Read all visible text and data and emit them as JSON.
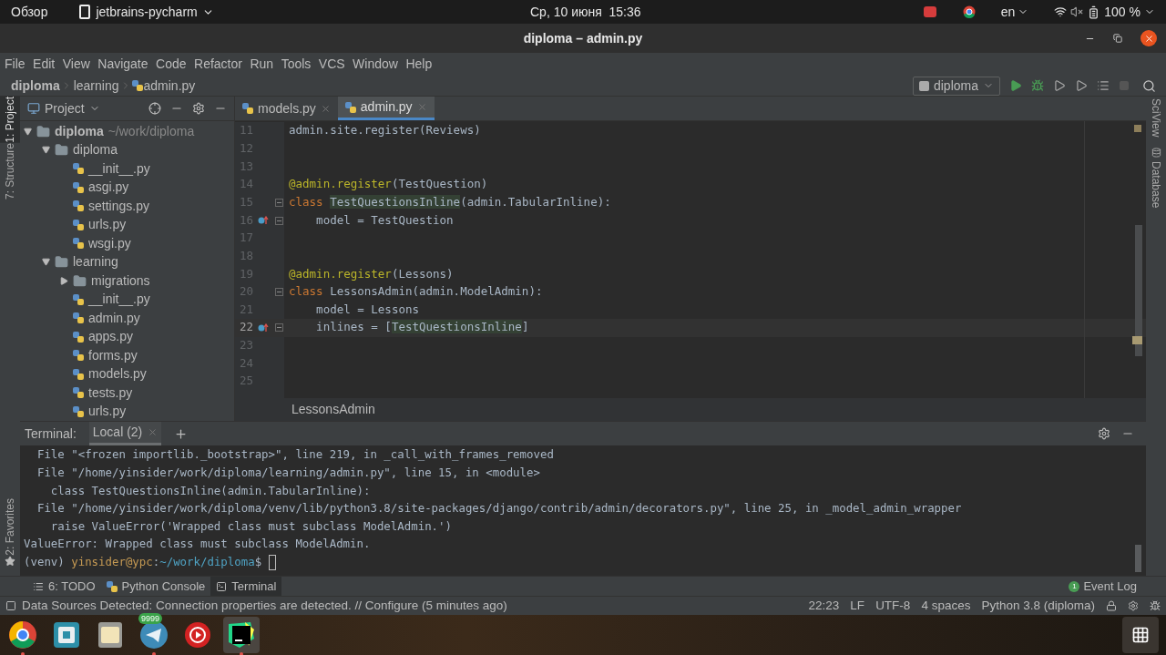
{
  "top_bar": {
    "activities": "Обзор",
    "app": "jetbrains-pycharm",
    "clock": "Ср, 10 июня  15:36",
    "language": "en",
    "battery": "100 %"
  },
  "window": {
    "title": "diploma – admin.py"
  },
  "menu": [
    "File",
    "Edit",
    "View",
    "Navigate",
    "Code",
    "Refactor",
    "Run",
    "Tools",
    "VCS",
    "Window",
    "Help"
  ],
  "breadcrumbs": [
    {
      "label": "diploma",
      "kind": "project"
    },
    {
      "label": "learning",
      "kind": "folder"
    },
    {
      "label": "admin.py",
      "kind": "file"
    }
  ],
  "run_config": "diploma",
  "left_stripe": [
    {
      "label": "1: Project",
      "selected": true
    },
    {
      "label": "7: Structure",
      "selected": false
    }
  ],
  "favorites": "2: Favorites",
  "right_stripe": [
    {
      "label": "SciView",
      "kind": "plain"
    },
    {
      "label": "Database",
      "kind": "database"
    }
  ],
  "project_panel": {
    "title": "Project",
    "tree": [
      {
        "name": "diploma",
        "hint": "~/work/diploma",
        "kind": "folder",
        "expanded": true,
        "children": [
          {
            "name": "diploma",
            "kind": "folder",
            "expanded": true,
            "children": [
              {
                "name": "__init__.py",
                "kind": "file"
              },
              {
                "name": "asgi.py",
                "kind": "file"
              },
              {
                "name": "settings.py",
                "kind": "file"
              },
              {
                "name": "urls.py",
                "kind": "file"
              },
              {
                "name": "wsgi.py",
                "kind": "file"
              }
            ]
          },
          {
            "name": "learning",
            "kind": "folder",
            "expanded": true,
            "children": [
              {
                "name": "migrations",
                "kind": "folder",
                "expanded": false
              },
              {
                "name": "__init__.py",
                "kind": "file"
              },
              {
                "name": "admin.py",
                "kind": "file"
              },
              {
                "name": "apps.py",
                "kind": "file"
              },
              {
                "name": "forms.py",
                "kind": "file"
              },
              {
                "name": "models.py",
                "kind": "file"
              },
              {
                "name": "tests.py",
                "kind": "file"
              },
              {
                "name": "urls.py",
                "kind": "file"
              }
            ]
          }
        ]
      }
    ]
  },
  "editor_tabs": [
    {
      "label": "models.py",
      "selected": false
    },
    {
      "label": "admin.py",
      "selected": true
    }
  ],
  "code": [
    {
      "number": "11",
      "current": false,
      "override": false,
      "fold": false,
      "segments": [
        {
          "kind": "plain",
          "text": "admin.site.register(Reviews)"
        }
      ]
    },
    {
      "number": "12",
      "current": false,
      "override": false,
      "fold": false
    },
    {
      "number": "13",
      "current": false,
      "override": false,
      "fold": false
    },
    {
      "number": "14",
      "current": false,
      "override": false,
      "fold": false,
      "segments": [
        {
          "kind": "decorator",
          "text": "@admin.register"
        },
        {
          "kind": "plain",
          "text": "(TestQuestion)"
        }
      ]
    },
    {
      "number": "15",
      "current": false,
      "override": false,
      "fold": true,
      "segments": [
        {
          "kind": "keyword",
          "text": "class "
        },
        {
          "kind": "highlight",
          "text": "TestQuestionsInline"
        },
        {
          "kind": "plain",
          "text": "(admin.TabularInline):"
        }
      ]
    },
    {
      "number": "16",
      "current": false,
      "override": true,
      "fold": true,
      "segments": [
        {
          "kind": "plain",
          "text": "    model = TestQuestion"
        }
      ]
    },
    {
      "number": "17",
      "current": false,
      "override": false,
      "fold": false
    },
    {
      "number": "18",
      "current": false,
      "override": false,
      "fold": false
    },
    {
      "number": "19",
      "current": false,
      "override": false,
      "fold": false,
      "segments": [
        {
          "kind": "decorator",
          "text": "@admin.register"
        },
        {
          "kind": "plain",
          "text": "(Lessons)"
        }
      ]
    },
    {
      "number": "20",
      "current": false,
      "override": false,
      "fold": true,
      "segments": [
        {
          "kind": "keyword",
          "text": "class "
        },
        {
          "kind": "plain",
          "text": "LessonsAdmin(admin.ModelAdmin):"
        }
      ]
    },
    {
      "number": "21",
      "current": false,
      "override": false,
      "fold": false,
      "segments": [
        {
          "kind": "plain",
          "text": "    model = Lessons"
        }
      ]
    },
    {
      "number": "22",
      "current": true,
      "override": true,
      "fold": true,
      "segments": [
        {
          "kind": "plain",
          "text": "    inlines = ["
        },
        {
          "kind": "highlight",
          "text": "TestQuestionsInline"
        },
        {
          "kind": "plain",
          "text": "]"
        }
      ]
    },
    {
      "number": "23",
      "current": false,
      "override": false,
      "fold": false
    },
    {
      "number": "24",
      "current": false,
      "override": false,
      "fold": false
    },
    {
      "number": "25",
      "current": false,
      "override": false,
      "fold": false
    }
  ],
  "editor_breadcrumb": "LessonsAdmin",
  "terminal": {
    "title": "Terminal:",
    "tabs": [
      {
        "label": "Local (2)",
        "selected": true
      }
    ],
    "lines": [
      {
        "cursor": false,
        "segments": [
          {
            "kind": "plain",
            "text": "  File \"<frozen importlib._bootstrap>\", line 219, in _call_with_frames_removed"
          }
        ]
      },
      {
        "cursor": false,
        "segments": [
          {
            "kind": "plain",
            "text": "  File \"/home/yinsider/work/diploma/learning/admin.py\", line 15, in <module>"
          }
        ]
      },
      {
        "cursor": false,
        "segments": [
          {
            "kind": "plain",
            "text": "    class TestQuestionsInline(admin.TabularInline):"
          }
        ]
      },
      {
        "cursor": false,
        "segments": [
          {
            "kind": "plain",
            "text": "  File \"/home/yinsider/work/diploma/venv/lib/python3.8/site-packages/django/contrib/admin/decorators.py\", line 25, in _model_admin_wrapper"
          }
        ]
      },
      {
        "cursor": false,
        "segments": [
          {
            "kind": "plain",
            "text": "    raise ValueError('Wrapped class must subclass ModelAdmin.')"
          }
        ]
      },
      {
        "cursor": false,
        "segments": [
          {
            "kind": "plain",
            "text": "ValueError: Wrapped class must subclass ModelAdmin."
          }
        ]
      },
      {
        "cursor": true,
        "segments": [
          {
            "kind": "plain",
            "text": "(venv) "
          },
          {
            "kind": "user",
            "text": "yinsider@ypc"
          },
          {
            "kind": "plain",
            "text": ":"
          },
          {
            "kind": "path",
            "text": "~/work/diploma"
          },
          {
            "kind": "plain",
            "text": "$ "
          }
        ]
      }
    ]
  },
  "tool_tabs": [
    {
      "label": "6: TODO",
      "kind": "todo",
      "selected": false
    },
    {
      "label": "Python Console",
      "kind": "python",
      "selected": false
    },
    {
      "label": "Terminal",
      "kind": "terminal",
      "selected": true
    }
  ],
  "event_log": {
    "label": "Event Log",
    "count": "1"
  },
  "status": {
    "message": "Data Sources Detected: Connection properties are detected. // Configure (5 minutes ago)",
    "position": "22:23",
    "line_separator": "LF",
    "encoding": "UTF-8",
    "indent": "4 spaces",
    "interpreter": "Python 3.8 (diploma)"
  },
  "dock": [
    {
      "kind": "chrome",
      "running": true,
      "selected": false
    },
    {
      "kind": "remote",
      "running": false,
      "selected": false
    },
    {
      "kind": "files",
      "running": false,
      "selected": false
    },
    {
      "kind": "telegram",
      "badge": "9999",
      "running": true,
      "selected": false
    },
    {
      "kind": "music",
      "running": false,
      "selected": false
    },
    {
      "kind": "pycharm",
      "running": true,
      "selected": true
    }
  ]
}
